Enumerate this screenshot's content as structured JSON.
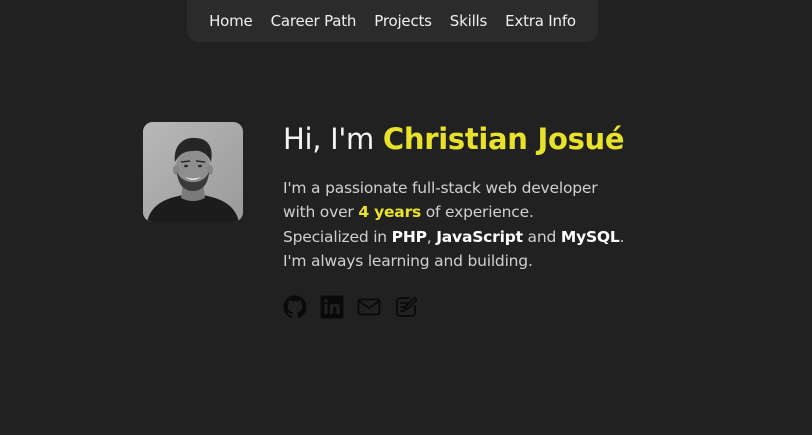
{
  "nav": {
    "items": [
      {
        "label": "Home"
      },
      {
        "label": "Career Path"
      },
      {
        "label": "Projects"
      },
      {
        "label": "Skills"
      },
      {
        "label": "Extra Info"
      }
    ]
  },
  "hero": {
    "greeting": "Hi, I'm ",
    "name": "Christian Josué",
    "bio": {
      "line1": "I'm a passionate full-stack web developer",
      "line2_pre": "with over ",
      "years": "4 years",
      "line2_post": " of experience.",
      "line3_pre": "Specialized in ",
      "skill1": "PHP",
      "sep1": ", ",
      "skill2": "JavaScript",
      "sep2": " and ",
      "skill3": "MySQL",
      "line3_post": ".",
      "line4": "I'm always learning and building."
    },
    "socials": [
      {
        "icon": "github-icon"
      },
      {
        "icon": "linkedin-icon"
      },
      {
        "icon": "mail-icon"
      },
      {
        "icon": "notes-icon"
      }
    ]
  },
  "colors": {
    "background": "#212121",
    "nav_background": "#2b2b2b",
    "accent": "#e9e22b",
    "icons": "#0a0a0a"
  }
}
